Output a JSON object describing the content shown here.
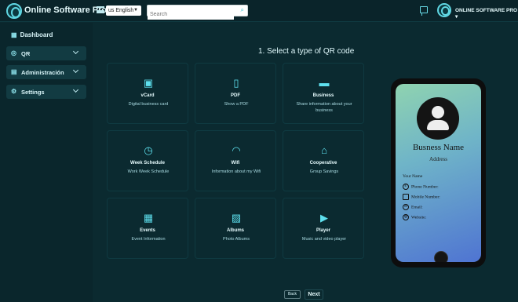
{
  "header": {
    "brand": "Online Software Pro",
    "language": "us English",
    "search_placeholder": "Search",
    "user_name": "ONLINE SOFTWARE PRO ▾"
  },
  "sidebar": {
    "dashboard": "Dashboard",
    "items": [
      {
        "label": "QR",
        "icon": "qr-icon"
      },
      {
        "label": "Administración",
        "icon": "admin-icon"
      },
      {
        "label": "Settings",
        "icon": "gear-icon"
      }
    ]
  },
  "main": {
    "title": "1. Select a type of QR code",
    "cards": [
      {
        "title": "vCard",
        "desc": "Digital business card",
        "icon": "id-card-icon"
      },
      {
        "title": "PDF",
        "desc": "Show a PDF",
        "icon": "pdf-icon"
      },
      {
        "title": "Business",
        "desc": "Share information about your business",
        "icon": "briefcase-icon"
      },
      {
        "title": "Week Schedule",
        "desc": "Work Week Schedule",
        "icon": "clock-icon"
      },
      {
        "title": "Wifi",
        "desc": "Information about my Wifi",
        "icon": "wifi-icon"
      },
      {
        "title": "Cooperative",
        "desc": "Group Savings",
        "icon": "bank-icon"
      },
      {
        "title": "Events",
        "desc": "Event Information",
        "icon": "calendar-icon"
      },
      {
        "title": "Albums",
        "desc": "Photo Albums",
        "icon": "image-icon"
      },
      {
        "title": "Player",
        "desc": "Music and video player",
        "icon": "play-icon"
      }
    ]
  },
  "preview": {
    "business_name": "Busness Name",
    "address": "Address",
    "your_name": "Your Name",
    "phone_label": "Phone Number:",
    "mobile_label": "Mobile Number:",
    "email_label": "Email:",
    "website_label": "Website:"
  },
  "footer": {
    "back_label": "Back",
    "next_label": "Next"
  },
  "colors": {
    "background": "#0b2a30",
    "accent": "#5ee0ee"
  }
}
